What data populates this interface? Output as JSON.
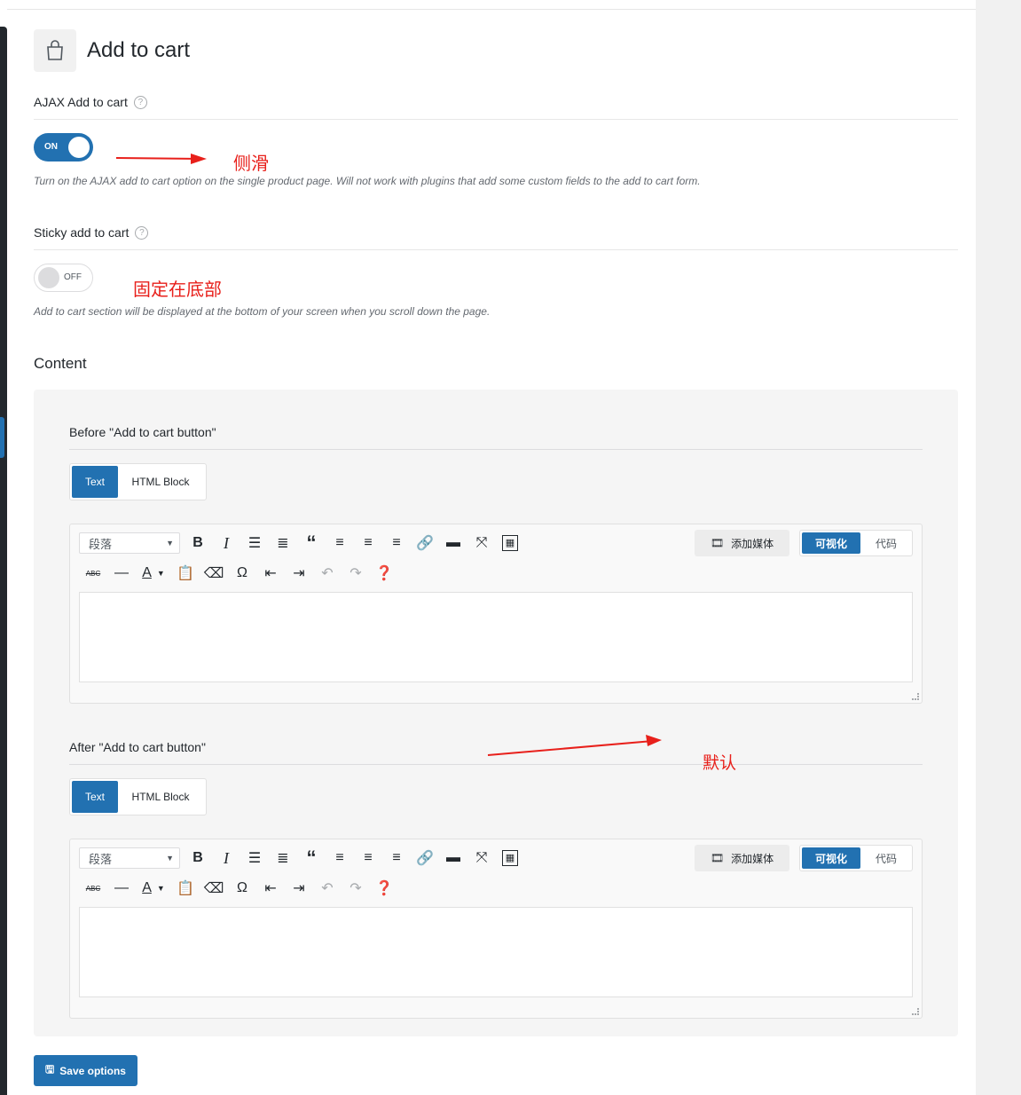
{
  "page": {
    "title": "Add to cart",
    "title_icon": "shopping-bag-icon"
  },
  "ajax": {
    "label": "AJAX Add to cart",
    "help": "?",
    "toggle_text": "ON",
    "enabled": true,
    "description": "Turn on the AJAX add to cart option on the single product page. Will not work with plugins that add some custom fields to the add to cart form.",
    "annotation": "侧滑"
  },
  "sticky": {
    "label": "Sticky add to cart",
    "help": "?",
    "toggle_text": "OFF",
    "enabled": false,
    "description": "Add to cart section will be displayed at the bottom of your screen when you scroll down the page.",
    "annotation": "固定在底部"
  },
  "content": {
    "title": "Content",
    "before": {
      "label": "Before \"Add to cart button\"",
      "tabs": [
        "Text",
        "HTML Block"
      ],
      "active_tab": "Text"
    },
    "after": {
      "label": "After \"Add to cart button\"",
      "tabs": [
        "Text",
        "HTML Block"
      ],
      "active_tab": "Text",
      "annotation": "默认"
    }
  },
  "editor": {
    "format": "段落",
    "media_button": "添加媒体",
    "mode_visual": "可视化",
    "mode_code": "代码",
    "toolbar_row1": [
      "bold-icon",
      "italic-icon",
      "bullet-list-icon",
      "numbered-list-icon",
      "blockquote-icon",
      "align-left-icon",
      "align-center-icon",
      "align-right-icon",
      "link-icon",
      "read-more-icon",
      "fullscreen-icon",
      "toolbar-toggle-icon"
    ],
    "toolbar_row2": [
      "strikethrough-icon",
      "horizontal-line-icon",
      "text-color-icon",
      "paste-text-icon",
      "clear-formatting-icon",
      "special-character-icon",
      "outdent-icon",
      "indent-icon",
      "undo-icon",
      "redo-icon",
      "help-icon"
    ]
  },
  "save_button": "Save options",
  "colors": {
    "primary": "#2271b1",
    "annotation": "#e8201b",
    "sidebar": "#23282d"
  }
}
